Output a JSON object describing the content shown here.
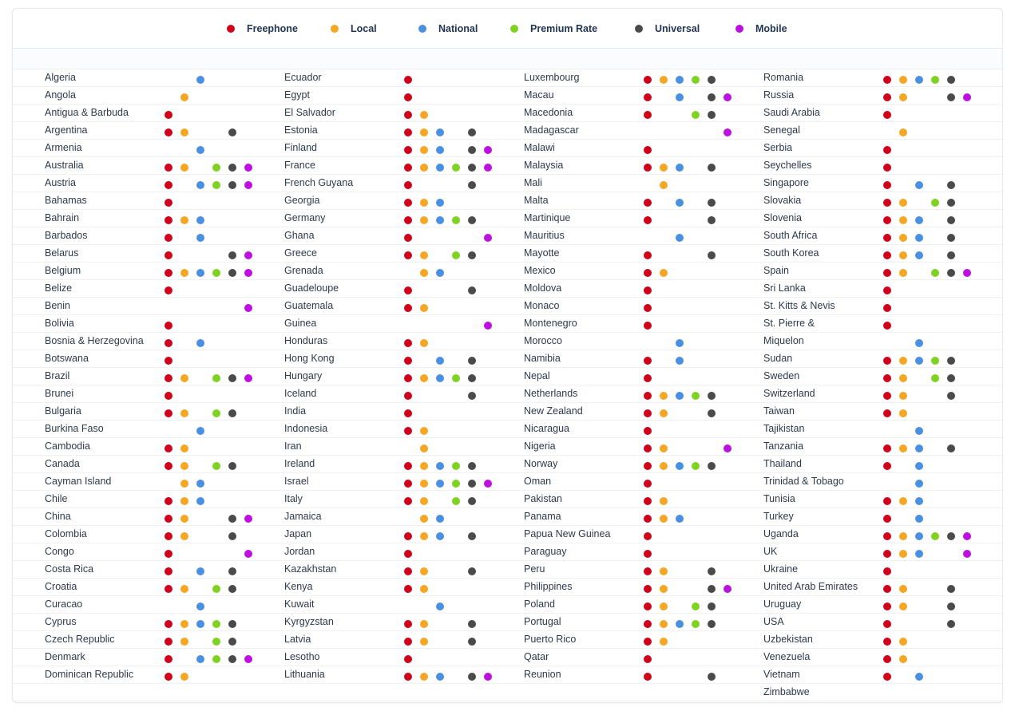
{
  "legend": [
    {
      "key": "F",
      "label": "Freephone",
      "color": "#d0021b",
      "icon": "freephone-dot-icon"
    },
    {
      "key": "L",
      "label": "Local",
      "color": "#f5a623",
      "icon": "local-dot-icon"
    },
    {
      "key": "N",
      "label": "National",
      "color": "#4a90e2",
      "icon": "national-dot-icon"
    },
    {
      "key": "P",
      "label": "Premium Rate",
      "color": "#7ed321",
      "icon": "premium-rate-dot-icon"
    },
    {
      "key": "U",
      "label": "Universal",
      "color": "#4a4a4a",
      "icon": "universal-dot-icon"
    },
    {
      "key": "M",
      "label": "Mobile",
      "color": "#bd10e0",
      "icon": "mobile-dot-icon"
    }
  ],
  "columns": [
    [
      {
        "name": "Algeria",
        "types": "N"
      },
      {
        "name": "Angola",
        "types": "L"
      },
      {
        "name": "Antigua & Barbuda",
        "types": "F"
      },
      {
        "name": "Argentina",
        "types": "FLU"
      },
      {
        "name": "Armenia",
        "types": "N"
      },
      {
        "name": "Australia",
        "types": "FLPUM"
      },
      {
        "name": "Austria",
        "types": "FNPUM"
      },
      {
        "name": "Bahamas",
        "types": "F"
      },
      {
        "name": "Bahrain",
        "types": "FLN"
      },
      {
        "name": "Barbados",
        "types": "FN"
      },
      {
        "name": "Belarus",
        "types": "FUM"
      },
      {
        "name": "Belgium",
        "types": "FLNPUM"
      },
      {
        "name": "Belize",
        "types": "F"
      },
      {
        "name": "Benin",
        "types": "M"
      },
      {
        "name": "Bolivia",
        "types": "F"
      },
      {
        "name": "Bosnia & Herzegovina",
        "types": "FN"
      },
      {
        "name": "Botswana",
        "types": "F"
      },
      {
        "name": "Brazil",
        "types": "FLPUM"
      },
      {
        "name": "Brunei",
        "types": "F"
      },
      {
        "name": "Bulgaria",
        "types": "FLPU"
      },
      {
        "name": "Burkina Faso",
        "types": "N"
      },
      {
        "name": "Cambodia",
        "types": "FL"
      },
      {
        "name": "Canada",
        "types": "FLPU"
      },
      {
        "name": "Cayman Island",
        "types": "LN"
      },
      {
        "name": "Chile",
        "types": "FLN"
      },
      {
        "name": "China",
        "types": "FLUM"
      },
      {
        "name": "Colombia",
        "types": "FLU"
      },
      {
        "name": "Congo",
        "types": "FM"
      },
      {
        "name": "Costa Rica",
        "types": "FNU"
      },
      {
        "name": "Croatia",
        "types": "FLPU"
      },
      {
        "name": "Curacao",
        "types": "N"
      },
      {
        "name": "Cyprus",
        "types": "FLNPU"
      },
      {
        "name": "Czech Republic",
        "types": "FLPU"
      },
      {
        "name": "Denmark",
        "types": "FNPUM"
      },
      {
        "name": "Dominican Republic",
        "types": "FL"
      }
    ],
    [
      {
        "name": "Ecuador",
        "types": "F"
      },
      {
        "name": "Egypt",
        "types": "F"
      },
      {
        "name": "El Salvador",
        "types": "FL"
      },
      {
        "name": "Estonia",
        "types": "FLNU"
      },
      {
        "name": "Finland",
        "types": "FLNUM"
      },
      {
        "name": "France",
        "types": "FLNPUM"
      },
      {
        "name": "French Guyana",
        "types": "FU"
      },
      {
        "name": "Georgia",
        "types": "FLN"
      },
      {
        "name": "Germany",
        "types": "FLNPU"
      },
      {
        "name": "Ghana",
        "types": "FM"
      },
      {
        "name": "Greece",
        "types": "FLPU"
      },
      {
        "name": "Grenada",
        "types": "LN"
      },
      {
        "name": "Guadeloupe",
        "types": "FU"
      },
      {
        "name": "Guatemala",
        "types": "FL"
      },
      {
        "name": "Guinea",
        "types": "M"
      },
      {
        "name": "Honduras",
        "types": "FL"
      },
      {
        "name": "Hong Kong",
        "types": "FNU"
      },
      {
        "name": "Hungary",
        "types": "FLNPU"
      },
      {
        "name": "Iceland",
        "types": "FU"
      },
      {
        "name": "India",
        "types": "F"
      },
      {
        "name": "Indonesia",
        "types": "FL"
      },
      {
        "name": "Iran",
        "types": "L"
      },
      {
        "name": "Ireland",
        "types": "FLNPU"
      },
      {
        "name": "Israel",
        "types": "FLNPUM"
      },
      {
        "name": "Italy",
        "types": "FLPU"
      },
      {
        "name": "Jamaica",
        "types": "LN"
      },
      {
        "name": "Japan",
        "types": "FLNU"
      },
      {
        "name": "Jordan",
        "types": "F"
      },
      {
        "name": "Kazakhstan",
        "types": "FLU"
      },
      {
        "name": "Kenya",
        "types": "FL"
      },
      {
        "name": "Kuwait",
        "types": "N"
      },
      {
        "name": "Kyrgyzstan",
        "types": "FLU"
      },
      {
        "name": "Latvia",
        "types": "FLU"
      },
      {
        "name": "Lesotho",
        "types": "F"
      },
      {
        "name": "Lithuania",
        "types": "FLNUM"
      }
    ],
    [
      {
        "name": "Luxembourg",
        "types": "FLNPU"
      },
      {
        "name": "Macau",
        "types": "FNUM"
      },
      {
        "name": "Macedonia",
        "types": "FPU"
      },
      {
        "name": "Madagascar",
        "types": "M"
      },
      {
        "name": "Malawi",
        "types": "F"
      },
      {
        "name": "Malaysia",
        "types": "FLNU"
      },
      {
        "name": "Mali",
        "types": "L"
      },
      {
        "name": "Malta",
        "types": "FNU"
      },
      {
        "name": "Martinique",
        "types": "FU"
      },
      {
        "name": "Mauritius",
        "types": "N"
      },
      {
        "name": "Mayotte",
        "types": "FU"
      },
      {
        "name": "Mexico",
        "types": "FL"
      },
      {
        "name": "Moldova",
        "types": "F"
      },
      {
        "name": "Monaco",
        "types": "F"
      },
      {
        "name": "Montenegro",
        "types": "F"
      },
      {
        "name": "Morocco",
        "types": "N"
      },
      {
        "name": "Namibia",
        "types": "FN"
      },
      {
        "name": "Nepal",
        "types": "F"
      },
      {
        "name": "Netherlands",
        "types": "FLNPU"
      },
      {
        "name": "New Zealand",
        "types": "FLU"
      },
      {
        "name": "Nicaragua",
        "types": "F"
      },
      {
        "name": "Nigeria",
        "types": "FLM"
      },
      {
        "name": "Norway",
        "types": "FLNPU"
      },
      {
        "name": "Oman",
        "types": "F"
      },
      {
        "name": "Pakistan",
        "types": "FL"
      },
      {
        "name": "Panama",
        "types": "FLN"
      },
      {
        "name": "Papua New Guinea",
        "types": "F"
      },
      {
        "name": "Paraguay",
        "types": "F"
      },
      {
        "name": "Peru",
        "types": "FLU"
      },
      {
        "name": "Philippines",
        "types": "FLUM"
      },
      {
        "name": "Poland",
        "types": "FLPU"
      },
      {
        "name": "Portugal",
        "types": "FLNPU"
      },
      {
        "name": "Puerto Rico",
        "types": "FL"
      },
      {
        "name": "Qatar",
        "types": "F"
      },
      {
        "name": "Reunion",
        "types": "FU"
      }
    ],
    [
      {
        "name": "Romania",
        "types": "FLNPU"
      },
      {
        "name": "Russia",
        "types": "FLUM"
      },
      {
        "name": "Saudi Arabia",
        "types": "F"
      },
      {
        "name": "Senegal",
        "types": "L"
      },
      {
        "name": "Serbia",
        "types": "F"
      },
      {
        "name": "Seychelles",
        "types": "F"
      },
      {
        "name": "Singapore",
        "types": "FNU"
      },
      {
        "name": "Slovakia",
        "types": "FLPU"
      },
      {
        "name": "Slovenia",
        "types": "FLNU"
      },
      {
        "name": "South Africa",
        "types": "FLNU"
      },
      {
        "name": "South Korea",
        "types": "FLNU"
      },
      {
        "name": "Spain",
        "types": "FLPUM"
      },
      {
        "name": "Sri Lanka",
        "types": "F"
      },
      {
        "name": "St. Kitts & Nevis",
        "types": "F"
      },
      {
        "name": "St. Pierre &",
        "types": "F"
      },
      {
        "name": "Miquelon",
        "types": "N"
      },
      {
        "name": "Sudan",
        "types": "FLNPU"
      },
      {
        "name": "Sweden",
        "types": "FLPU"
      },
      {
        "name": "Switzerland",
        "types": "FLU"
      },
      {
        "name": "Taiwan",
        "types": "FL"
      },
      {
        "name": "Tajikistan",
        "types": "N"
      },
      {
        "name": "Tanzania",
        "types": "FLNU"
      },
      {
        "name": "Thailand",
        "types": "FN"
      },
      {
        "name": "Trinidad & Tobago",
        "types": "N"
      },
      {
        "name": "Tunisia",
        "types": "FLN"
      },
      {
        "name": "Turkey",
        "types": "FN"
      },
      {
        "name": "Uganda",
        "types": "FLNPUM"
      },
      {
        "name": "UK",
        "types": "FLNM"
      },
      {
        "name": "Ukraine",
        "types": "F"
      },
      {
        "name": "United Arab Emirates",
        "types": "FLU"
      },
      {
        "name": "Uruguay",
        "types": "FLU"
      },
      {
        "name": "USA",
        "types": "FU"
      },
      {
        "name": "Uzbekistan",
        "types": "FL"
      },
      {
        "name": "Venezuela",
        "types": "FL"
      },
      {
        "name": "Vietnam",
        "types": "FN"
      },
      {
        "name": "Zimbabwe",
        "types": ""
      }
    ]
  ]
}
